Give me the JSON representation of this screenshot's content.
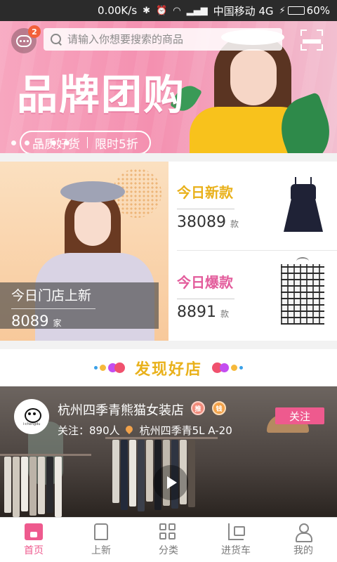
{
  "status_bar": {
    "speed": "0.00K/s",
    "carrier": "中国移动 4G",
    "battery_percent": "60%",
    "battery_level": 0.6
  },
  "header": {
    "message_badge": "2",
    "search_placeholder": "请输入你想要搜索的商品"
  },
  "banner": {
    "title": "品牌团购",
    "tag_left": "品质好货",
    "tag_right": "限时5折",
    "active_slide": 1,
    "slide_count": 5
  },
  "promo": {
    "left": {
      "title": "今日门店上新",
      "count": "8089",
      "unit": "家"
    },
    "new": {
      "title": "今日新款",
      "count": "38089",
      "unit": "款"
    },
    "hot": {
      "title": "今日爆款",
      "count": "8891",
      "unit": "款"
    }
  },
  "discover": {
    "title": "发现好店"
  },
  "store": {
    "logo_text": "i-chengdu",
    "name": "杭州四季青熊猫女装店",
    "badge1": "推",
    "badge2": "钱",
    "followers_label": "关注：890人",
    "location": "杭州四季青5L A-20",
    "follow_label": "关注"
  },
  "tabs": [
    {
      "label": "首页",
      "icon": "home-icon",
      "active": true
    },
    {
      "label": "上新",
      "icon": "shirt-icon",
      "active": false
    },
    {
      "label": "分类",
      "icon": "grid-icon",
      "active": false
    },
    {
      "label": "进货车",
      "icon": "cart-icon",
      "active": false
    },
    {
      "label": "我的",
      "icon": "user-icon",
      "active": false
    }
  ],
  "colors": {
    "accent_pink": "#ee5a8e",
    "accent_gold": "#e9b11b",
    "hot_pink": "#e35d9c"
  }
}
